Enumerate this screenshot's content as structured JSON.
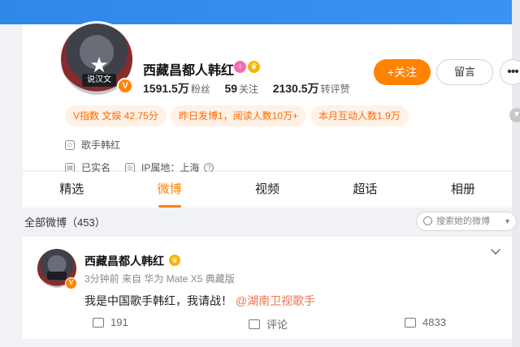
{
  "profile": {
    "name": "西藏昌都人韩红",
    "avatar_badge_text": "说汉文",
    "verified_badge": "V",
    "stats": [
      {
        "value": "1591.5万",
        "label": "粉丝"
      },
      {
        "value": "59",
        "label": "关注"
      },
      {
        "value": "2130.5万",
        "label": "转评赞"
      }
    ],
    "follow_label": "+关注",
    "message_label": "留言",
    "more_label": "•••",
    "pills": [
      "V指数 文娱 42.75分",
      "昨日发博1，阅读人数10万+",
      "本月互动人数1.9万"
    ],
    "description": "歌手韩红",
    "verification": "已实名",
    "ip_location": "IP属地：上海"
  },
  "tabs": [
    "精选",
    "微博",
    "视频",
    "超话",
    "相册"
  ],
  "active_tab": 1,
  "feed": {
    "all_label": "全部微博（453）",
    "search_placeholder": "搜索她的微博"
  },
  "post": {
    "author": "西藏昌都人韩红",
    "meta": "3分钟前  来自 华为 Mate X5 典藏版",
    "text": "我是中国歌手韩红，我请战！",
    "mention": "@湖南卫视歌手",
    "reposts": "191",
    "comments_label": "评论",
    "likes": "4833"
  },
  "colors": {
    "accent": "#ff8200",
    "banner": "#3a93f2",
    "pill_text": "#ff6a00",
    "pill_bg": "#fff1e6",
    "mention": "#eb7350"
  }
}
